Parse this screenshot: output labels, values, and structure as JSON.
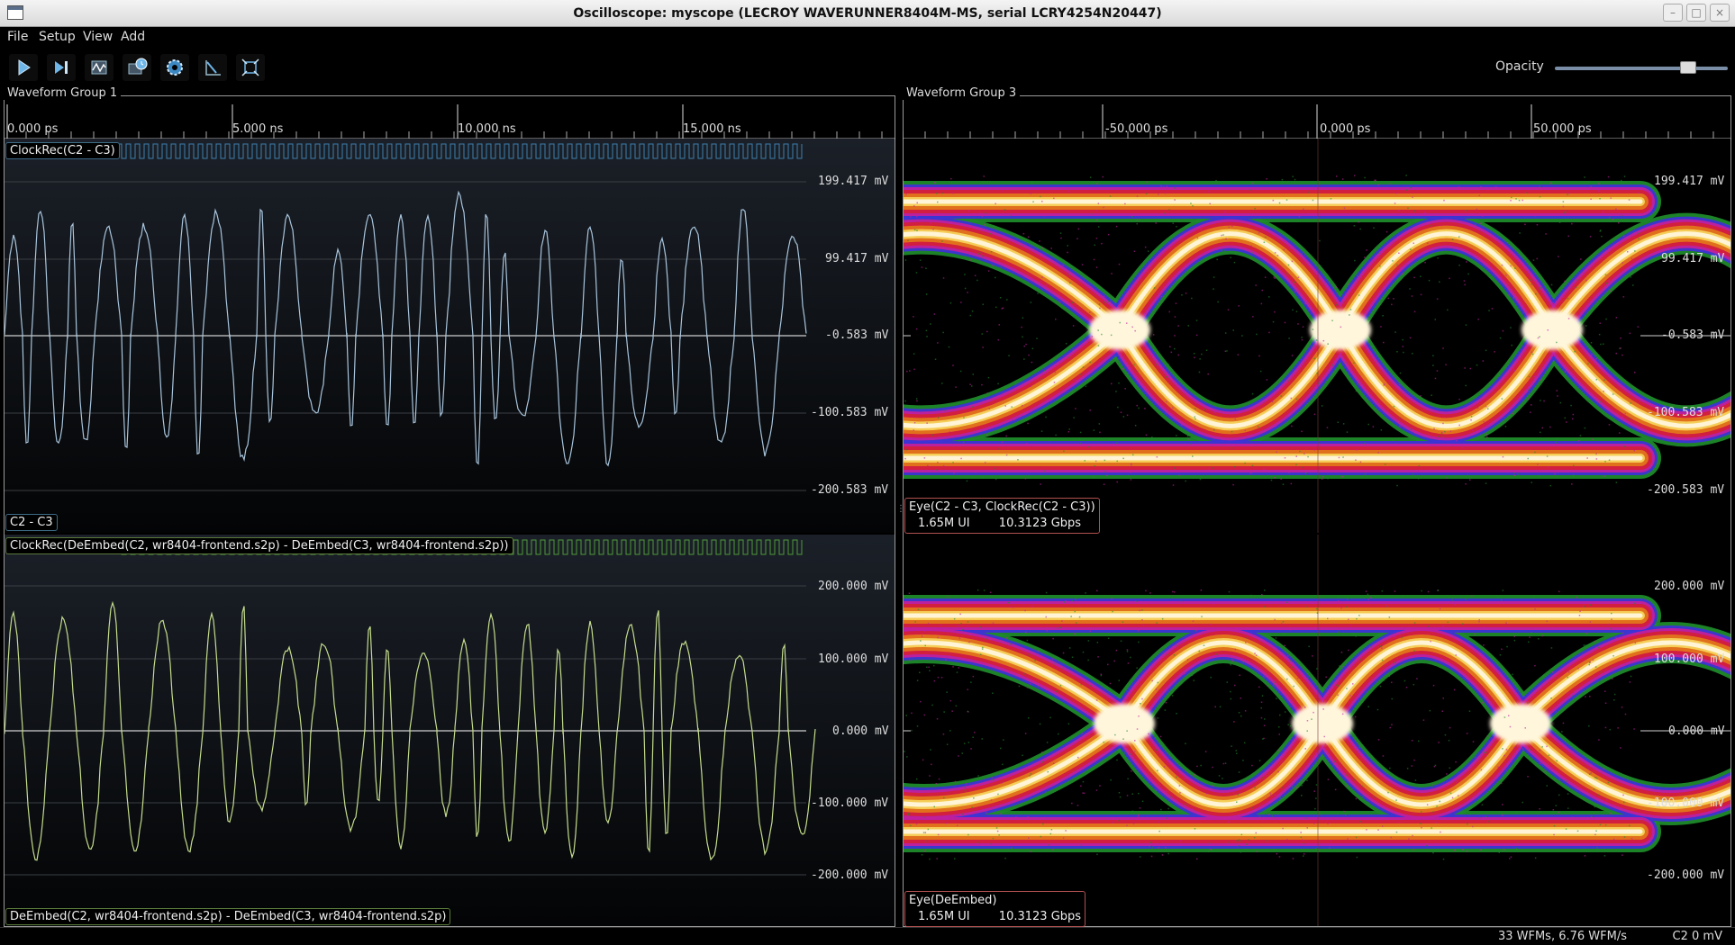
{
  "window": {
    "title": "Oscilloscope: myscope (LECROY WAVERUNNER8404M-MS, serial LCRY4254N20447)",
    "buttons": [
      "–",
      "□",
      "×"
    ]
  },
  "menu": [
    "File",
    "Setup",
    "View",
    "Add"
  ],
  "toolbar": {
    "tools": [
      "start-trigger",
      "single-trigger",
      "waveform",
      "history",
      "settings",
      "measure",
      "fullscreen"
    ],
    "opacity_label": "Opacity",
    "opacity_value": 0.8
  },
  "group1": {
    "title": "Waveform Group 1",
    "x_ticks": [
      "0.000 ps",
      "5.000 ns",
      "10.000 ns",
      "15.000 ns"
    ],
    "top": {
      "clock_label": "ClockRec(C2 - C3)",
      "trace_label": "C2 - C3",
      "y_ticks": [
        "199.417 mV",
        "99.417 mV",
        "-0.583 mV",
        "-100.583 mV",
        "-200.583 mV"
      ]
    },
    "bottom": {
      "clock_label": "ClockRec(DeEmbed(C2, wr8404-frontend.s2p) - DeEmbed(C3, wr8404-frontend.s2p))",
      "trace_label": "DeEmbed(C2, wr8404-frontend.s2p) - DeEmbed(C3, wr8404-frontend.s2p)",
      "y_ticks": [
        "200.000 mV",
        "100.000 mV",
        "0.000 mV",
        "-100.000 mV",
        "-200.000 mV"
      ]
    }
  },
  "group3": {
    "title": "Waveform Group 3",
    "x_ticks": [
      "-50.000 ps",
      "0.000 ps",
      "50.000 ps"
    ],
    "top": {
      "eye_name": "Eye(C2 - C3, ClockRec(C2 - C3))",
      "ui_count": "1.65M UI",
      "rate": "10.3123 Gbps",
      "y_ticks": [
        "199.417 mV",
        "99.417 mV",
        "-0.583 mV",
        "-100.583 mV",
        "-200.583 mV"
      ]
    },
    "bottom": {
      "eye_name": "Eye(DeEmbed)",
      "ui_count": "1.65M UI",
      "rate": "10.3123 Gbps",
      "y_ticks": [
        "200.000 mV",
        "100.000 mV",
        "0.000 mV",
        "-100.000 mV",
        "-200.000 mV"
      ]
    }
  },
  "status": {
    "wfms": "33 WFMs, 6.76 WFM/s",
    "trigger": "C2 0 mV"
  },
  "colors": {
    "trace_top": "#a8c4dc",
    "trace_bottom": "#c4dc8c",
    "clock_top": "#3d7fae",
    "clock_bottom": "#4f9a3a"
  }
}
